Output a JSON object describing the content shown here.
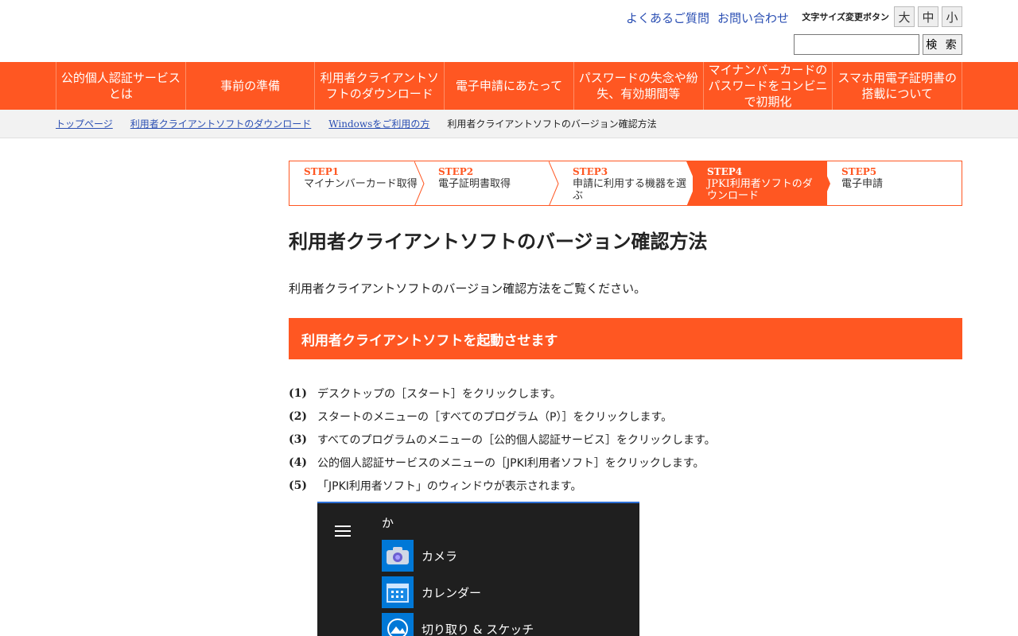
{
  "header": {
    "faq": "よくあるご質問",
    "contact": "お問い合わせ",
    "fontsize_label": "文字サイズ変更ボタン",
    "fontsize_large": "大",
    "fontsize_medium": "中",
    "fontsize_small": "小",
    "search_placeholder": "",
    "search_button": "検 索"
  },
  "nav": {
    "items": [
      {
        "label": "公的個人認証サービスとは"
      },
      {
        "label": "事前の準備"
      },
      {
        "label": "利用者クライアントソフトのダウンロード"
      },
      {
        "label": "電子申請にあたって"
      },
      {
        "label": "パスワードの失念や紛失、有効期間等"
      },
      {
        "label": "マイナンバーカードのパスワードをコンビニで初期化"
      },
      {
        "label": "スマホ用電子証明書の搭載について"
      }
    ]
  },
  "breadcrumb": {
    "items": [
      {
        "label": "トップページ"
      },
      {
        "label": "利用者クライアントソフトのダウンロード"
      },
      {
        "label": "Windowsをご利用の方"
      }
    ],
    "current": "利用者クライアントソフトのバージョン確認方法"
  },
  "steps": [
    {
      "num": "STEP1",
      "label": "マイナンバーカード取得"
    },
    {
      "num": "STEP2",
      "label": "電子証明書取得"
    },
    {
      "num": "STEP3",
      "label": "申請に利用する機器を選ぶ"
    },
    {
      "num": "STEP4",
      "label": "JPKI利用者ソフトのダウンロード"
    },
    {
      "num": "STEP5",
      "label": "電子申請"
    }
  ],
  "content": {
    "title": "利用者クライアントソフトのバージョン確認方法",
    "lead": "利用者クライアントソフトのバージョン確認方法をご覧ください。",
    "section_title": "利用者クライアントソフトを起動させます",
    "instructions": [
      {
        "n": "(1)",
        "text": "デスクトップの［スタート］をクリックします。"
      },
      {
        "n": "(2)",
        "text": "スタートのメニューの［すべてのプログラム（P）］をクリックします。"
      },
      {
        "n": "(3)",
        "text": "すべてのプログラムのメニューの［公的個人認証サービス］をクリックします。"
      },
      {
        "n": "(4)",
        "text": "公的個人認証サービスのメニューの［JPKI利用者ソフト］をクリックします。"
      },
      {
        "n": "(5)",
        "text": "「JPKI利用者ソフト」のウィンドウが表示されます。"
      }
    ]
  },
  "screenshot": {
    "letter": "か",
    "apps": [
      {
        "name": "カメラ",
        "icon": "camera-icon"
      },
      {
        "name": "カレンダー",
        "icon": "calendar-icon"
      },
      {
        "name": "切り取り & スケッチ",
        "icon": "snip-sketch-icon"
      }
    ]
  },
  "colors": {
    "accent": "#ff5722",
    "link": "#2b4fb3"
  }
}
